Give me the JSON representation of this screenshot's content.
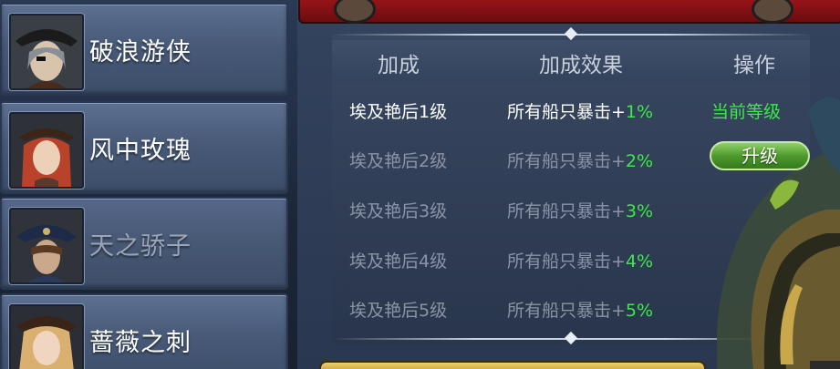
{
  "characters": [
    {
      "name": "破浪游侠",
      "enabled": true,
      "icon": "pirate-hat-portrait-icon"
    },
    {
      "name": "风中玫瑰",
      "enabled": true,
      "icon": "red-hair-portrait-icon"
    },
    {
      "name": "天之骄子",
      "enabled": false,
      "icon": "tricorn-portrait-icon"
    },
    {
      "name": "蔷薇之刺",
      "enabled": true,
      "icon": "blonde-portrait-icon"
    }
  ],
  "table": {
    "headers": {
      "bonus": "加成",
      "effect": "加成效果",
      "action": "操作"
    },
    "rows": [
      {
        "name": "埃及艳后1级",
        "effect": "所有船只暴击+",
        "pct": "1%"
      },
      {
        "name": "埃及艳后2级",
        "effect": "所有船只暴击+",
        "pct": "2%"
      },
      {
        "name": "埃及艳后3级",
        "effect": "所有船只暴击+",
        "pct": "3%"
      },
      {
        "name": "埃及艳后4级",
        "effect": "所有船只暴击+",
        "pct": "4%"
      },
      {
        "name": "埃及艳后5级",
        "effect": "所有船只暴击+",
        "pct": "5%"
      }
    ],
    "current_level_label": "当前等级",
    "upgrade_label": "升级"
  },
  "colors": {
    "accent_green": "#3ee84a",
    "banner_red": "#a0161a"
  }
}
